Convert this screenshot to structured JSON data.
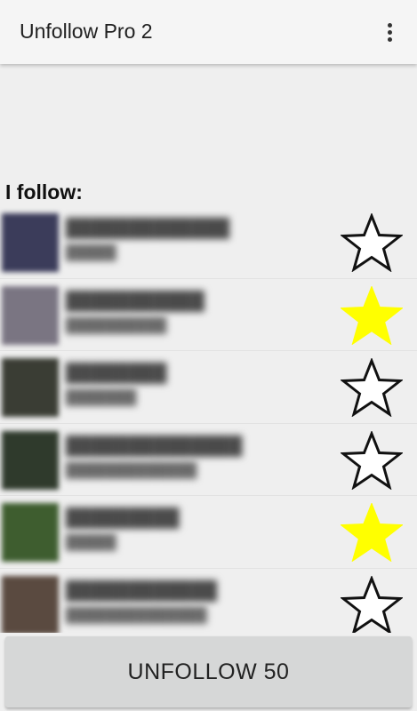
{
  "app": {
    "title": "Unfollow Pro 2",
    "menu_icon": "more-vert-icon"
  },
  "section": {
    "heading": "I follow:"
  },
  "follows": [
    {
      "name": "█████████████",
      "subtitle": "█████",
      "starred": false,
      "avatar_color": "#3b3c5a"
    },
    {
      "name": "███████████",
      "subtitle": "██████████",
      "starred": true,
      "avatar_color": "#7a7582"
    },
    {
      "name": "████████",
      "subtitle": "███████",
      "starred": false,
      "avatar_color": "#3a3d34"
    },
    {
      "name": "██████████████",
      "subtitle": "█████████████",
      "starred": false,
      "avatar_color": "#2f3a2c"
    },
    {
      "name": "█████████",
      "subtitle": "█████",
      "starred": true,
      "avatar_color": "#3e5d2f"
    },
    {
      "name": "████████████",
      "subtitle": "██████████████",
      "starred": false,
      "avatar_color": "#5a4a40"
    }
  ],
  "colors": {
    "star_active": "#ffff00",
    "star_inactive_outline": "#111111"
  },
  "actions": {
    "unfollow_label": "UNFOLLOW 50"
  }
}
